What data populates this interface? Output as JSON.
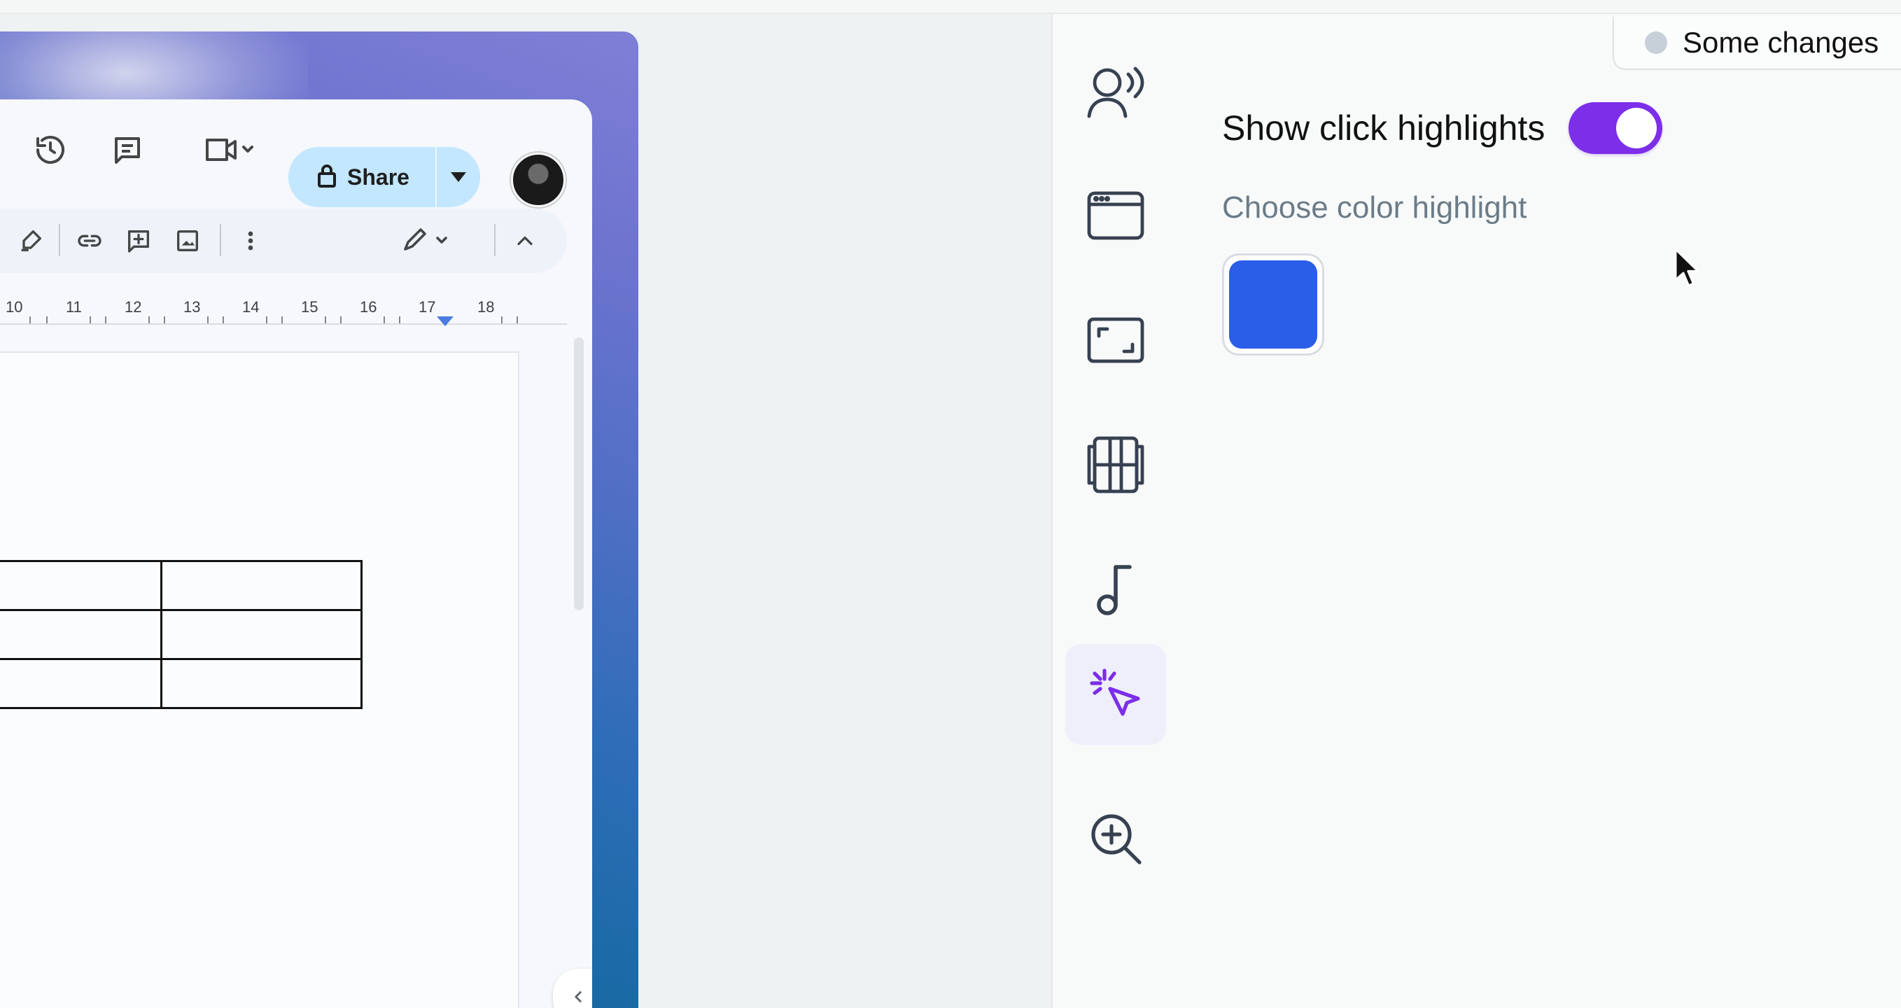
{
  "doc_preview": {
    "toolbar": {
      "share_label": "Share",
      "icons": [
        "version-history-icon",
        "comments-icon",
        "meet-camera-icon",
        "lock-icon",
        "chevron-down-icon"
      ]
    },
    "format_toolbar": {
      "icons": [
        "highlighter-icon",
        "link-icon",
        "add-comment-icon",
        "insert-image-icon",
        "more-vertical-icon",
        "edit-pencil-icon",
        "chevron-up-icon"
      ]
    },
    "ruler": {
      "labels": [
        "10",
        "11",
        "12",
        "13",
        "14",
        "15",
        "16",
        "17",
        "18"
      ]
    },
    "table": {
      "rows": 3,
      "cols": 2
    }
  },
  "side_rail": {
    "items": [
      {
        "icon": "voice-narration-icon"
      },
      {
        "icon": "browser-window-icon"
      },
      {
        "icon": "frame-crop-icon"
      },
      {
        "icon": "film-media-icon"
      },
      {
        "icon": "music-note-icon"
      },
      {
        "icon": "click-cursor-icon",
        "active": true
      },
      {
        "icon": "zoom-in-icon"
      }
    ]
  },
  "settings": {
    "status_text": "Some changes",
    "toggle_label": "Show click highlights",
    "toggle_on": true,
    "color_heading": "Choose color highlight",
    "selected_color": "#2a5ee8",
    "accent_color": "#7c2ee8"
  }
}
